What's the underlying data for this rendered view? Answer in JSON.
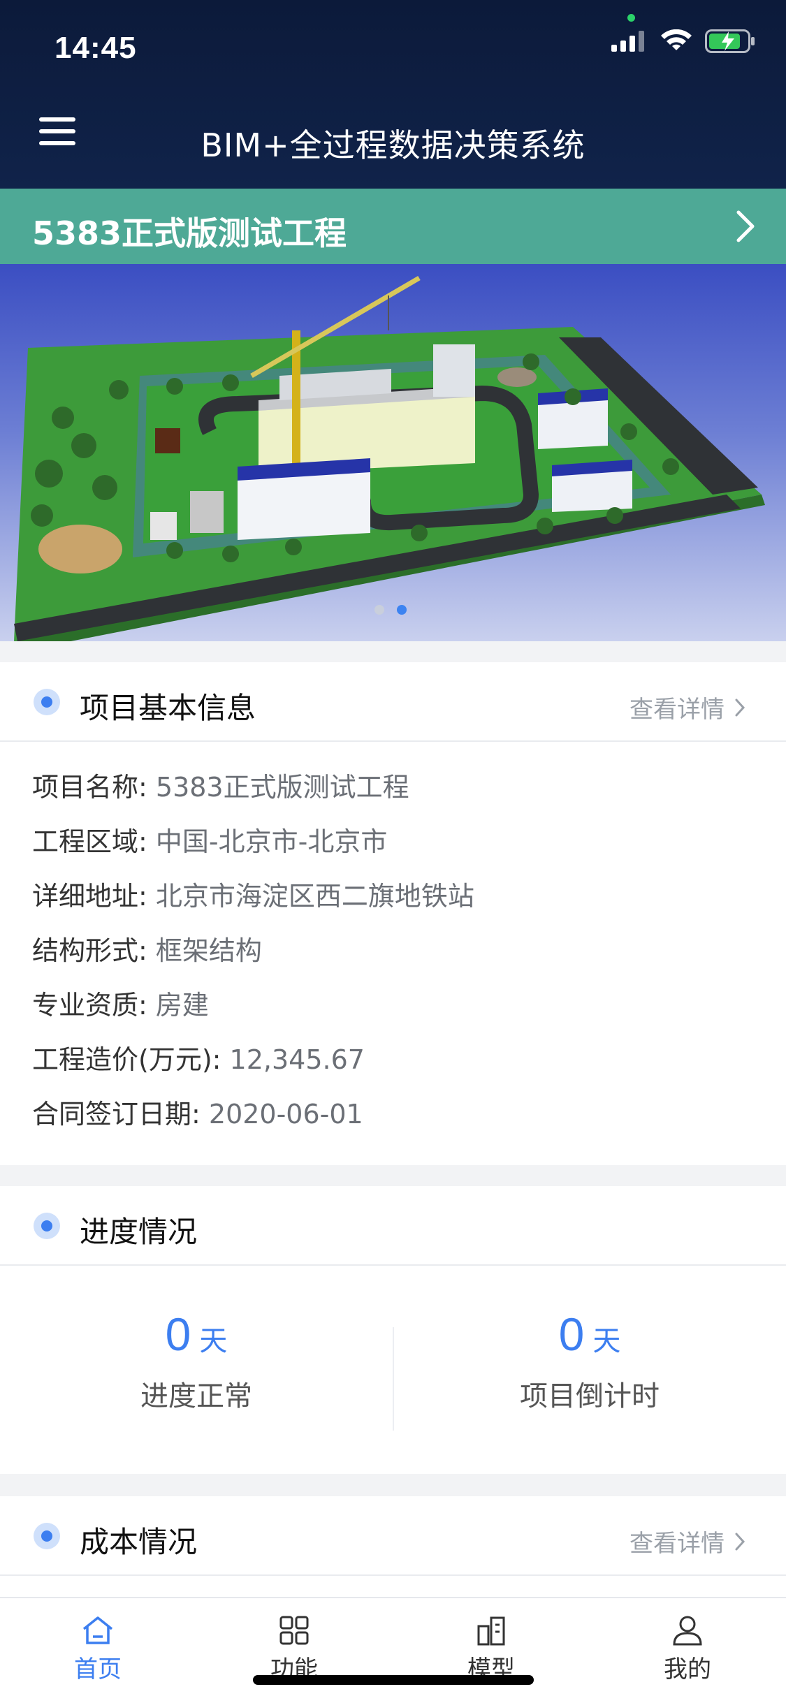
{
  "status_bar": {
    "time": "14:45"
  },
  "header": {
    "title": "BIM+全过程数据决策系统"
  },
  "project": {
    "name": "5383正式版测试工程"
  },
  "carousel": {
    "slide_count": 2,
    "active_index": 1
  },
  "basic_info": {
    "title": "项目基本信息",
    "detail_link": "查看详情",
    "rows": [
      {
        "label": "项目名称: ",
        "value": "5383正式版测试工程"
      },
      {
        "label": "工程区域: ",
        "value": "中国-北京市-北京市"
      },
      {
        "label": "详细地址: ",
        "value": "北京市海淀区西二旗地铁站"
      },
      {
        "label": "结构形式: ",
        "value": "框架结构"
      },
      {
        "label": "专业资质: ",
        "value": "房建"
      },
      {
        "label": "工程造价(万元): ",
        "value": "12,345.67"
      },
      {
        "label": "合同签订日期: ",
        "value": "2020-06-01"
      }
    ]
  },
  "progress": {
    "title": "进度情况",
    "stats": [
      {
        "value": "0",
        "unit": "天",
        "label": "进度正常"
      },
      {
        "value": "0",
        "unit": "天",
        "label": "项目倒计时"
      }
    ]
  },
  "cost": {
    "title": "成本情况",
    "detail_link": "查看详情"
  },
  "tabs": [
    {
      "label": "首页",
      "icon": "home-icon",
      "active": true
    },
    {
      "label": "功能",
      "icon": "grid-icon",
      "active": false
    },
    {
      "label": "模型",
      "icon": "building-icon",
      "active": false
    },
    {
      "label": "我的",
      "icon": "user-icon",
      "active": false
    }
  ],
  "colors": {
    "header_bg": "#0c1a3a",
    "project_bar": "#4ea996",
    "accent": "#3c7ef0"
  }
}
